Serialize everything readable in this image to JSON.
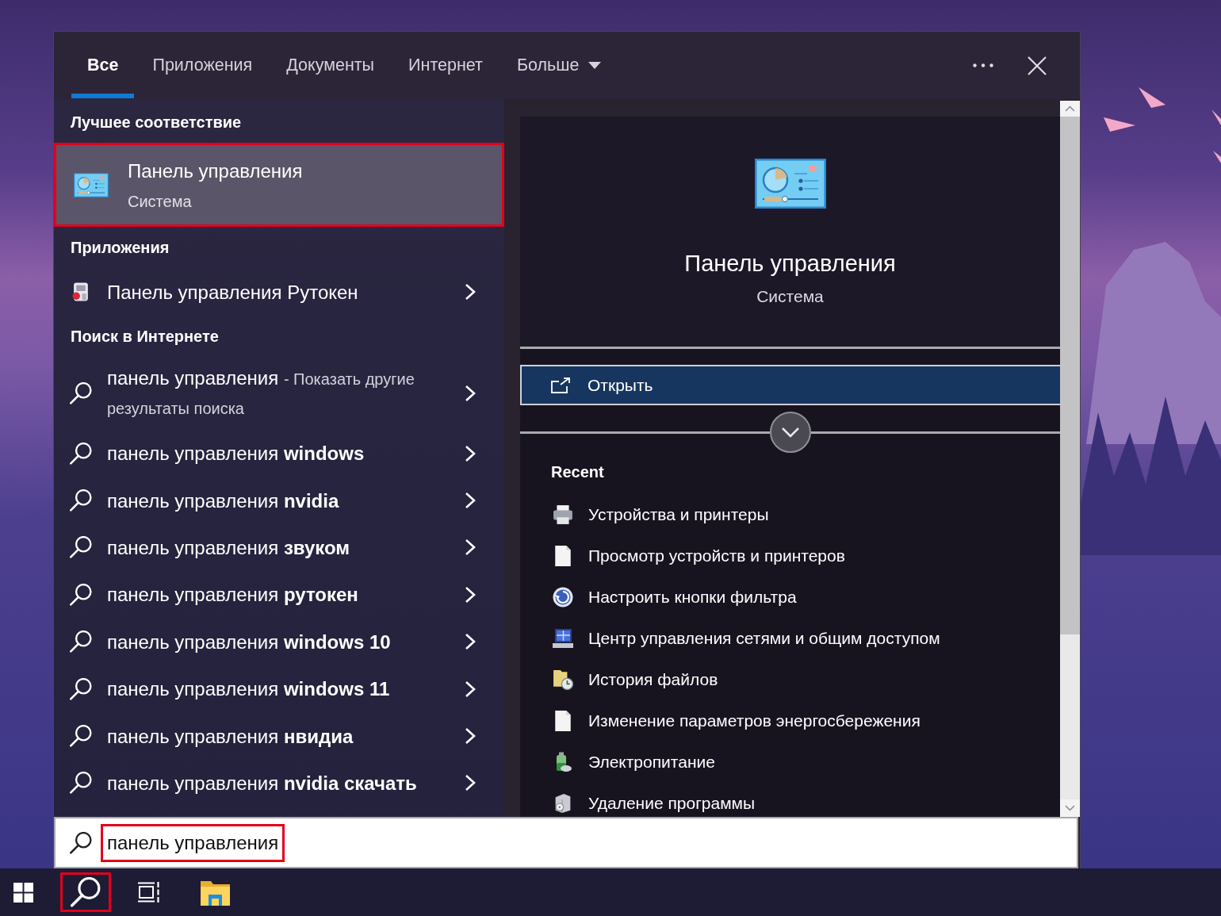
{
  "tabs": [
    {
      "label": "Все",
      "kind": "tab",
      "selected": true
    },
    {
      "label": "Приложения",
      "kind": "tab",
      "selected": false
    },
    {
      "label": "Документы",
      "kind": "tab",
      "selected": false
    },
    {
      "label": "Интернет",
      "kind": "tab",
      "selected": false
    },
    {
      "label": "Больше",
      "kind": "menu",
      "selected": false
    }
  ],
  "best_match": {
    "heading": "Лучшее соответствие",
    "title": "Панель управления",
    "subtitle": "Система",
    "selected": true,
    "marked": true
  },
  "apps": {
    "heading": "Приложения",
    "items": [
      {
        "title": "Панель управления Рутокен",
        "selected": false
      }
    ]
  },
  "web_search": {
    "heading": "Поиск в Интернете",
    "items": [
      {
        "text": "панель управления",
        "note": "- Показать другие результаты поиска",
        "selected": false
      },
      {
        "text": "панель управления **windows**",
        "selected": false
      },
      {
        "text": "панель управления **nvidia**",
        "selected": false
      },
      {
        "text": "панель управления **звуком**",
        "selected": false
      },
      {
        "text": "панель управления **рутокен**",
        "selected": false
      },
      {
        "text": "панель управления **windows 10**",
        "selected": false
      },
      {
        "text": "панель управления **windows 11**",
        "selected": false
      },
      {
        "text": "панель управления **нвидиа**",
        "selected": false
      },
      {
        "text": "панель управления **nvidia скачать**",
        "selected": false
      }
    ]
  },
  "preview": {
    "title": "Панель управления",
    "subtitle": "Система",
    "actions": [
      {
        "label": "Открыть",
        "selected": true
      }
    ],
    "recent": {
      "heading": "Recent",
      "items": [
        "Устройства и принтеры",
        "Просмотр устройств и принтеров",
        "Настроить кнопки фильтра",
        "Центр управления сетями и общим доступом",
        "История файлов",
        "Изменение параметров энергосбережения",
        "Электропитание",
        "Удаление программы"
      ]
    }
  },
  "search_box": {
    "value": "панель управления",
    "marked": true
  },
  "taskbar": {
    "buttons": [
      {
        "marked": false
      },
      {
        "marked": true
      },
      {
        "marked": false
      },
      {
        "marked": false
      }
    ]
  }
}
